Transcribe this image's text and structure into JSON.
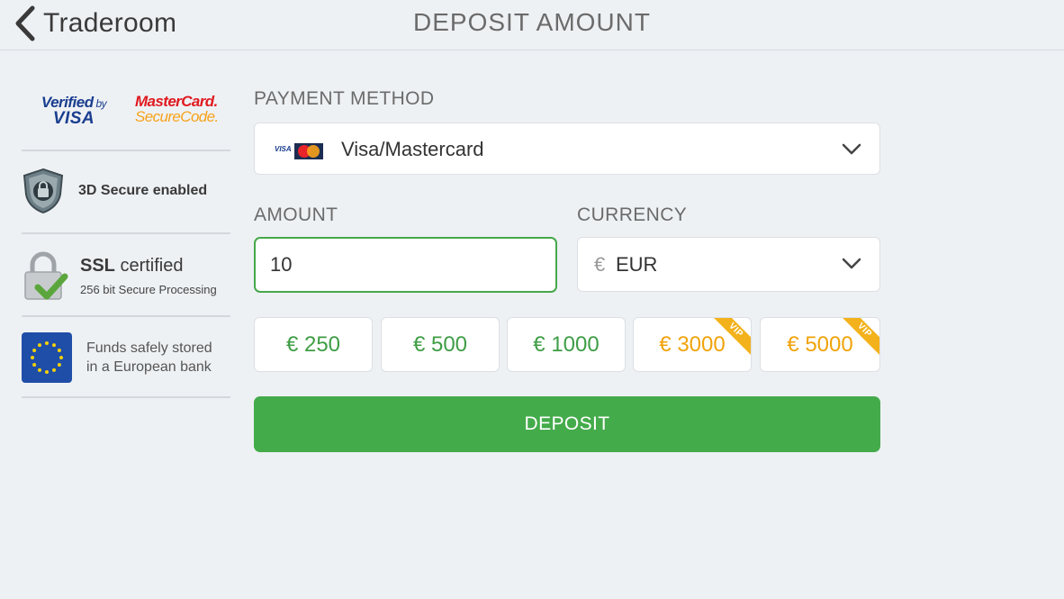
{
  "header": {
    "back_label": "Traderoom",
    "title": "DEPOSIT AMOUNT"
  },
  "trust": {
    "visa_top": "Verified",
    "visa_by": "by",
    "visa_bottom": "VISA",
    "mc_top": "MasterCard.",
    "mc_bottom": "SecureCode.",
    "secure3d": "3D Secure enabled",
    "ssl_bold": "SSL",
    "ssl_rest": " certified",
    "ssl_sub": "256 bit Secure Processing",
    "eu_line1": "Funds safely stored",
    "eu_line2": "in a European bank"
  },
  "form": {
    "payment_method_label": "PAYMENT METHOD",
    "payment_method_value": "Visa/Mastercard",
    "amount_label": "AMOUNT",
    "amount_value": "10",
    "currency_label": "CURRENCY",
    "currency_symbol": "€",
    "currency_value": "EUR",
    "presets": [
      "€ 250",
      "€ 500",
      "€ 1000",
      "€ 3000",
      "€ 5000"
    ],
    "vip_badge": "VIP",
    "deposit_label": "DEPOSIT"
  },
  "colors": {
    "accent_green": "#44ab4b",
    "vip_gold": "#f0a30a"
  }
}
